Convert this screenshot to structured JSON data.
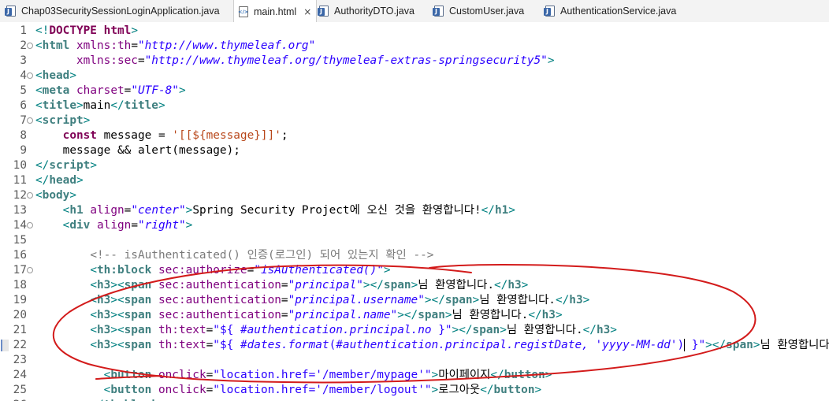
{
  "tabs": [
    {
      "label": "Chap03SecuritySessionLoginApplication.java",
      "icon": "java-file-icon",
      "active": false
    },
    {
      "label": "main.html",
      "icon": "html-file-icon",
      "active": true,
      "close": "×"
    },
    {
      "label": "AuthorityDTO.java",
      "icon": "java-file-icon",
      "active": false
    },
    {
      "label": "CustomUser.java",
      "icon": "java-file-icon",
      "active": false
    },
    {
      "label": "AuthenticationService.java",
      "icon": "java-file-icon",
      "active": false
    }
  ],
  "lines": [
    {
      "n": "1",
      "fold": false,
      "tokens": [
        [
          "t-br",
          "<!"
        ],
        [
          "t-doc",
          "DOCTYPE"
        ],
        [
          "t-txt",
          " "
        ],
        [
          "t-doc",
          "html"
        ],
        [
          "t-br",
          ">"
        ]
      ]
    },
    {
      "n": "2",
      "fold": true,
      "tokens": [
        [
          "t-br",
          "<"
        ],
        [
          "t-tagb",
          "html"
        ],
        [
          "t-txt",
          " "
        ],
        [
          "t-attr",
          "xmlns:th"
        ],
        [
          "t-txt",
          "="
        ],
        [
          "t-str",
          "\"http://www.thymeleaf.org\""
        ]
      ]
    },
    {
      "n": "3",
      "fold": false,
      "tokens": [
        [
          "t-txt",
          "      "
        ],
        [
          "t-attr",
          "xmlns:sec"
        ],
        [
          "t-txt",
          "="
        ],
        [
          "t-str",
          "\"http://www.thymeleaf.org/thymeleaf-extras-springsecurity5\""
        ],
        [
          "t-br",
          ">"
        ]
      ]
    },
    {
      "n": "4",
      "fold": true,
      "tokens": [
        [
          "t-br",
          "<"
        ],
        [
          "t-tagb",
          "head"
        ],
        [
          "t-br",
          ">"
        ]
      ]
    },
    {
      "n": "5",
      "fold": false,
      "tokens": [
        [
          "t-br",
          "<"
        ],
        [
          "t-tagb",
          "meta"
        ],
        [
          "t-txt",
          " "
        ],
        [
          "t-attr",
          "charset"
        ],
        [
          "t-txt",
          "="
        ],
        [
          "t-str",
          "\"UTF-8\""
        ],
        [
          "t-br",
          ">"
        ]
      ]
    },
    {
      "n": "6",
      "fold": false,
      "tokens": [
        [
          "t-br",
          "<"
        ],
        [
          "t-tagb",
          "title"
        ],
        [
          "t-br",
          ">"
        ],
        [
          "t-txt",
          "main"
        ],
        [
          "t-br",
          "</"
        ],
        [
          "t-tagb",
          "title"
        ],
        [
          "t-br",
          ">"
        ]
      ]
    },
    {
      "n": "7",
      "fold": true,
      "tokens": [
        [
          "t-br",
          "<"
        ],
        [
          "t-tagb",
          "script"
        ],
        [
          "t-br",
          ">"
        ]
      ]
    },
    {
      "n": "8",
      "fold": false,
      "tokens": [
        [
          "t-txt",
          "    "
        ],
        [
          "t-kw",
          "const"
        ],
        [
          "t-txt",
          " message = "
        ],
        [
          "t-jsstr",
          "'[[${message}]]'"
        ],
        [
          "t-txt",
          ";"
        ]
      ]
    },
    {
      "n": "9",
      "fold": false,
      "tokens": [
        [
          "t-txt",
          "    message && alert(message);"
        ]
      ]
    },
    {
      "n": "10",
      "fold": false,
      "tokens": [
        [
          "t-br",
          "</"
        ],
        [
          "t-tagb",
          "script"
        ],
        [
          "t-br",
          ">"
        ]
      ]
    },
    {
      "n": "11",
      "fold": false,
      "tokens": [
        [
          "t-br",
          "</"
        ],
        [
          "t-tagb",
          "head"
        ],
        [
          "t-br",
          ">"
        ]
      ]
    },
    {
      "n": "12",
      "fold": true,
      "tokens": [
        [
          "t-br",
          "<"
        ],
        [
          "t-tagb",
          "body"
        ],
        [
          "t-br",
          ">"
        ]
      ]
    },
    {
      "n": "13",
      "fold": false,
      "tokens": [
        [
          "t-txt",
          "    "
        ],
        [
          "t-br",
          "<"
        ],
        [
          "t-tagb",
          "h1"
        ],
        [
          "t-txt",
          " "
        ],
        [
          "t-attr",
          "align"
        ],
        [
          "t-txt",
          "="
        ],
        [
          "t-str",
          "\"center\""
        ],
        [
          "t-br",
          ">"
        ],
        [
          "t-txt",
          "Spring Security Project에 오신 것을 환영합니다!"
        ],
        [
          "t-br",
          "</"
        ],
        [
          "t-tagb",
          "h1"
        ],
        [
          "t-br",
          ">"
        ]
      ]
    },
    {
      "n": "14",
      "fold": true,
      "tokens": [
        [
          "t-txt",
          "    "
        ],
        [
          "t-br",
          "<"
        ],
        [
          "t-tagb",
          "div"
        ],
        [
          "t-txt",
          " "
        ],
        [
          "t-attr",
          "align"
        ],
        [
          "t-txt",
          "="
        ],
        [
          "t-str",
          "\"right\""
        ],
        [
          "t-br",
          ">"
        ]
      ]
    },
    {
      "n": "15",
      "fold": false,
      "tokens": []
    },
    {
      "n": "16",
      "fold": false,
      "tokens": [
        [
          "t-txt",
          "        "
        ],
        [
          "t-cmt",
          "<!-- isAuthenticated() 인증(로그인) 되어 있는지 확인 -->"
        ]
      ]
    },
    {
      "n": "17",
      "fold": true,
      "tokens": [
        [
          "t-txt",
          "        "
        ],
        [
          "t-br",
          "<"
        ],
        [
          "t-tagb",
          "th:block"
        ],
        [
          "t-txt",
          " "
        ],
        [
          "t-attr",
          "sec:authorize"
        ],
        [
          "t-txt",
          "="
        ],
        [
          "t-str",
          "\"isAuthenticated()\""
        ],
        [
          "t-br",
          ">"
        ]
      ]
    },
    {
      "n": "18",
      "fold": false,
      "tokens": [
        [
          "t-txt",
          "        "
        ],
        [
          "t-br",
          "<"
        ],
        [
          "t-tagb",
          "h3"
        ],
        [
          "t-br",
          "><"
        ],
        [
          "t-tagb",
          "span"
        ],
        [
          "t-txt",
          " "
        ],
        [
          "t-attr",
          "sec:authentication"
        ],
        [
          "t-txt",
          "="
        ],
        [
          "t-str",
          "\"principal\""
        ],
        [
          "t-br",
          "></"
        ],
        [
          "t-tagb",
          "span"
        ],
        [
          "t-br",
          ">"
        ],
        [
          "t-txt",
          "님 환영합니다."
        ],
        [
          "t-br",
          "</"
        ],
        [
          "t-tagb",
          "h3"
        ],
        [
          "t-br",
          ">"
        ]
      ]
    },
    {
      "n": "19",
      "fold": false,
      "tokens": [
        [
          "t-txt",
          "        "
        ],
        [
          "t-br",
          "<"
        ],
        [
          "t-tagb",
          "h3"
        ],
        [
          "t-br",
          "><"
        ],
        [
          "t-tagb",
          "span"
        ],
        [
          "t-txt",
          " "
        ],
        [
          "t-attr",
          "sec:authentication"
        ],
        [
          "t-txt",
          "="
        ],
        [
          "t-str",
          "\"principal.username\""
        ],
        [
          "t-br",
          "></"
        ],
        [
          "t-tagb",
          "span"
        ],
        [
          "t-br",
          ">"
        ],
        [
          "t-txt",
          "님 환영합니다."
        ],
        [
          "t-br",
          "</"
        ],
        [
          "t-tagb",
          "h3"
        ],
        [
          "t-br",
          ">"
        ]
      ]
    },
    {
      "n": "20",
      "fold": false,
      "tokens": [
        [
          "t-txt",
          "        "
        ],
        [
          "t-br",
          "<"
        ],
        [
          "t-tagb",
          "h3"
        ],
        [
          "t-br",
          "><"
        ],
        [
          "t-tagb",
          "span"
        ],
        [
          "t-txt",
          " "
        ],
        [
          "t-attr",
          "sec:authentication"
        ],
        [
          "t-txt",
          "="
        ],
        [
          "t-str",
          "\"principal.name\""
        ],
        [
          "t-br",
          "></"
        ],
        [
          "t-tagb",
          "span"
        ],
        [
          "t-br",
          ">"
        ],
        [
          "t-txt",
          "님 환영합니다."
        ],
        [
          "t-br",
          "</"
        ],
        [
          "t-tagb",
          "h3"
        ],
        [
          "t-br",
          ">"
        ]
      ]
    },
    {
      "n": "21",
      "fold": false,
      "tokens": [
        [
          "t-txt",
          "        "
        ],
        [
          "t-br",
          "<"
        ],
        [
          "t-tagb",
          "h3"
        ],
        [
          "t-br",
          "><"
        ],
        [
          "t-tagb",
          "span"
        ],
        [
          "t-txt",
          " "
        ],
        [
          "t-attr",
          "th:text"
        ],
        [
          "t-txt",
          "="
        ],
        [
          "t-strp",
          "\"${ "
        ],
        [
          "t-str",
          "#authentication.principal.no"
        ],
        [
          "t-strp",
          " }\""
        ],
        [
          "t-br",
          "></"
        ],
        [
          "t-tagb",
          "span"
        ],
        [
          "t-br",
          ">"
        ],
        [
          "t-txt",
          "님 환영합니다."
        ],
        [
          "t-br",
          "</"
        ],
        [
          "t-tagb",
          "h3"
        ],
        [
          "t-br",
          ">"
        ]
      ]
    },
    {
      "n": "22",
      "fold": false,
      "mark": true,
      "tokens": [
        [
          "t-txt",
          "        "
        ],
        [
          "t-br",
          "<"
        ],
        [
          "t-tagb",
          "h3"
        ],
        [
          "t-br",
          "><"
        ],
        [
          "t-tagb",
          "span"
        ],
        [
          "t-txt",
          " "
        ],
        [
          "t-attr",
          "th:text"
        ],
        [
          "t-txt",
          "="
        ],
        [
          "t-strp",
          "\"${ "
        ],
        [
          "t-str",
          "#dates.format"
        ],
        [
          "t-strp",
          "("
        ],
        [
          "t-str",
          "#authentication.principal.registDate, 'yyyy-MM-dd'"
        ],
        [
          "t-strp",
          ")"
        ],
        [
          "cursor",
          ""
        ],
        [
          "t-strp",
          " }\""
        ],
        [
          "t-br",
          "></"
        ],
        [
          "t-tagb",
          "span"
        ],
        [
          "t-br",
          ">"
        ],
        [
          "t-txt",
          "님 환영합니다."
        ]
      ]
    },
    {
      "n": "23",
      "fold": false,
      "tokens": []
    },
    {
      "n": "24",
      "fold": false,
      "tokens": [
        [
          "t-txt",
          "          "
        ],
        [
          "t-br",
          "<"
        ],
        [
          "t-tagb",
          "button"
        ],
        [
          "t-txt",
          " "
        ],
        [
          "t-attr",
          "onclick"
        ],
        [
          "t-txt",
          "="
        ],
        [
          "t-strp",
          "\"location.href='/member/mypage'\""
        ],
        [
          "t-br",
          ">"
        ],
        [
          "t-txt",
          "마이페이지"
        ],
        [
          "t-br",
          "</"
        ],
        [
          "t-tagb",
          "button"
        ],
        [
          "t-br",
          ">"
        ]
      ]
    },
    {
      "n": "25",
      "fold": false,
      "tokens": [
        [
          "t-txt",
          "          "
        ],
        [
          "t-br",
          "<"
        ],
        [
          "t-tagb",
          "button"
        ],
        [
          "t-txt",
          " "
        ],
        [
          "t-attr",
          "onclick"
        ],
        [
          "t-txt",
          "="
        ],
        [
          "t-strp",
          "\"location.href='/member/logout'\""
        ],
        [
          "t-br",
          ">"
        ],
        [
          "t-txt",
          "로그아웃"
        ],
        [
          "t-br",
          "</"
        ],
        [
          "t-tagb",
          "button"
        ],
        [
          "t-br",
          ">"
        ]
      ]
    },
    {
      "n": "26",
      "fold": false,
      "tokens": [
        [
          "t-txt",
          "        "
        ],
        [
          "t-br",
          "</"
        ],
        [
          "t-tagb",
          "th:block"
        ],
        [
          "t-br",
          ">"
        ]
      ]
    }
  ]
}
